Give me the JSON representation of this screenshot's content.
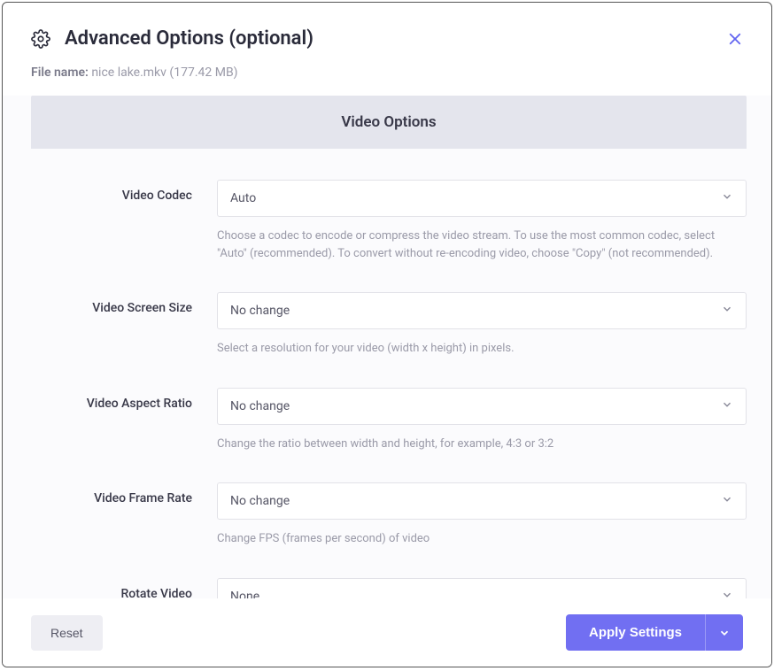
{
  "header": {
    "title": "Advanced Options (optional)"
  },
  "file": {
    "label": "File name:",
    "name": "nice lake.mkv",
    "size": "(177.42 MB)"
  },
  "section": {
    "title": "Video Options"
  },
  "fields": {
    "codec": {
      "label": "Video Codec",
      "value": "Auto",
      "help": "Choose a codec to encode or compress the video stream. To use the most common codec, select \"Auto\" (recommended). To convert without re-encoding video, choose \"Copy\" (not recommended)."
    },
    "screenSize": {
      "label": "Video Screen Size",
      "value": "No change",
      "help": "Select a resolution for your video (width x height) in pixels."
    },
    "aspectRatio": {
      "label": "Video Aspect Ratio",
      "value": "No change",
      "help": "Change the ratio between width and height, for example, 4:3 or 3:2"
    },
    "frameRate": {
      "label": "Video Frame Rate",
      "value": "No change",
      "help": "Change FPS (frames per second) of video"
    },
    "rotate": {
      "label": "Rotate Video",
      "value": "None"
    }
  },
  "footer": {
    "reset": "Reset",
    "apply": "Apply Settings"
  }
}
